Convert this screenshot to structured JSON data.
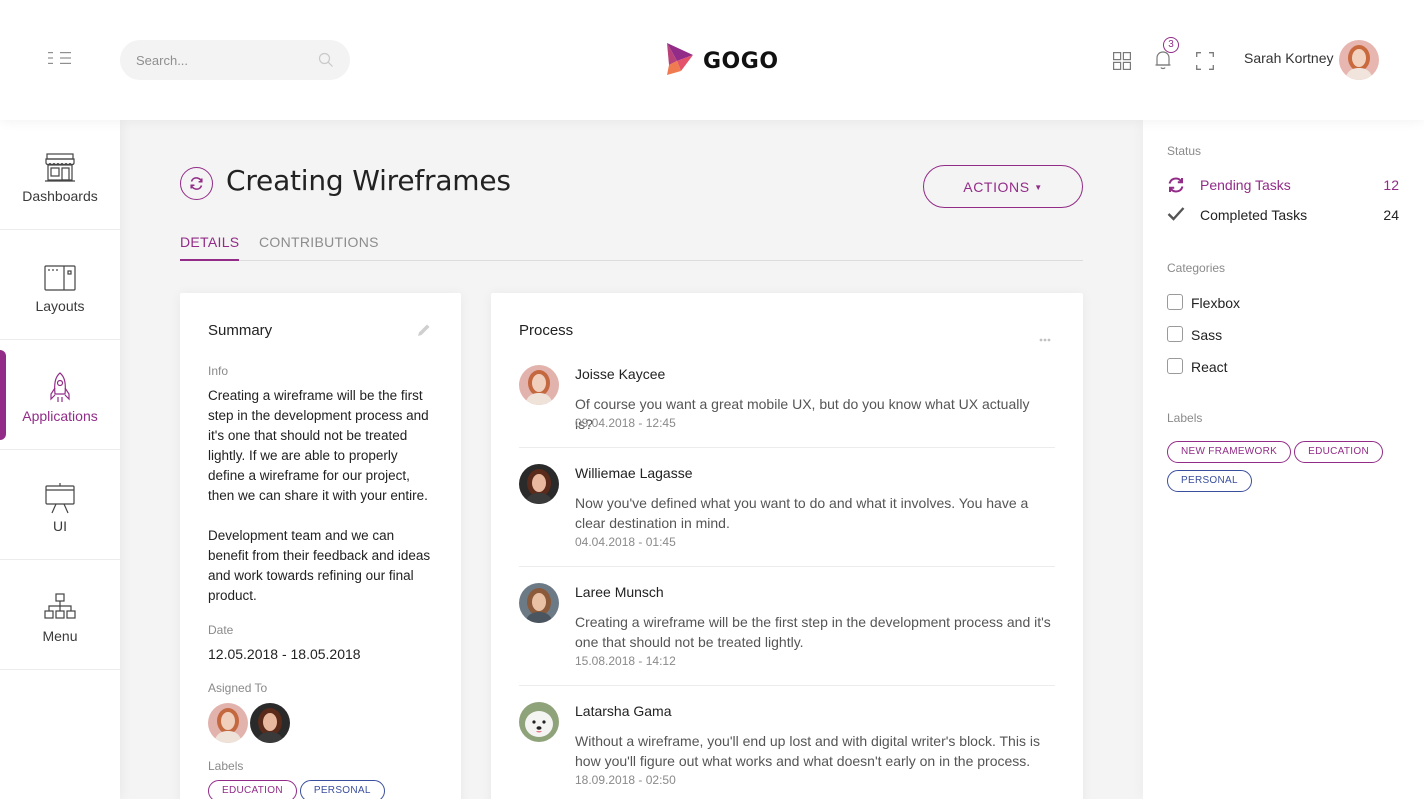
{
  "header": {
    "search_placeholder": "Search...",
    "logo_text": "GOGO",
    "notification_count": "3",
    "user_name": "Sarah Kortney"
  },
  "sidebar": {
    "items": [
      {
        "label": "Dashboards",
        "icon": "shop-icon"
      },
      {
        "label": "Layouts",
        "icon": "layout-icon"
      },
      {
        "label": "Applications",
        "icon": "rocket-icon",
        "active": true
      },
      {
        "label": "UI",
        "icon": "easel-icon"
      },
      {
        "label": "Menu",
        "icon": "hierarchy-icon"
      }
    ]
  },
  "main": {
    "title": "Creating Wireframes",
    "actions_label": "ACTIONS",
    "tabs": [
      {
        "label": "DETAILS",
        "active": true
      },
      {
        "label": "CONTRIBUTIONS",
        "active": false
      }
    ],
    "summary": {
      "title": "Summary",
      "info_label": "Info",
      "info_p1": "Creating a wireframe will be the first step in the development process and it's one that should not be treated lightly. If we are able to properly define a wireframe for our project, then we can share it with your entire.",
      "info_p2": "Development team and we can benefit from their feedback and ideas and work towards refining our final product.",
      "date_label": "Date",
      "date_value": "12.05.2018 - 18.05.2018",
      "assigned_label": "Asigned To",
      "labels_label": "Labels",
      "labels": [
        "EDUCATION",
        "PERSONAL"
      ]
    },
    "process": {
      "title": "Process",
      "items": [
        {
          "name": "Joisse Kaycee",
          "text": "Of course you want a great mobile UX, but do you know what UX actually is?",
          "time": "09.04.2018 - 12:45"
        },
        {
          "name": "Williemae Lagasse",
          "text": "Now you've defined what you want to do and what it involves. You have a clear destination in mind.",
          "time": "04.04.2018 - 01:45"
        },
        {
          "name": "Laree Munsch",
          "text": "Creating a wireframe will be the first step in the development process and it's one that should not be treated lightly.",
          "time": "15.08.2018 - 14:12"
        },
        {
          "name": "Latarsha Gama",
          "text": "Without a wireframe, you'll end up lost and with digital writer's block. This is how you'll figure out what works and what doesn't early on in the process.",
          "time": "18.09.2018 - 02:50"
        }
      ]
    }
  },
  "rightbar": {
    "status_label": "Status",
    "pending_label": "Pending Tasks",
    "pending_count": "12",
    "completed_label": "Completed Tasks",
    "completed_count": "24",
    "categories_label": "Categories",
    "categories": [
      "Flexbox",
      "Sass",
      "React"
    ],
    "labels_label": "Labels",
    "labels": [
      "NEW FRAMEWORK",
      "EDUCATION",
      "PERSONAL"
    ]
  },
  "colors": {
    "accent": "#922c88",
    "label_blue": "#3a4e9e",
    "background": "#f4f4f4"
  }
}
